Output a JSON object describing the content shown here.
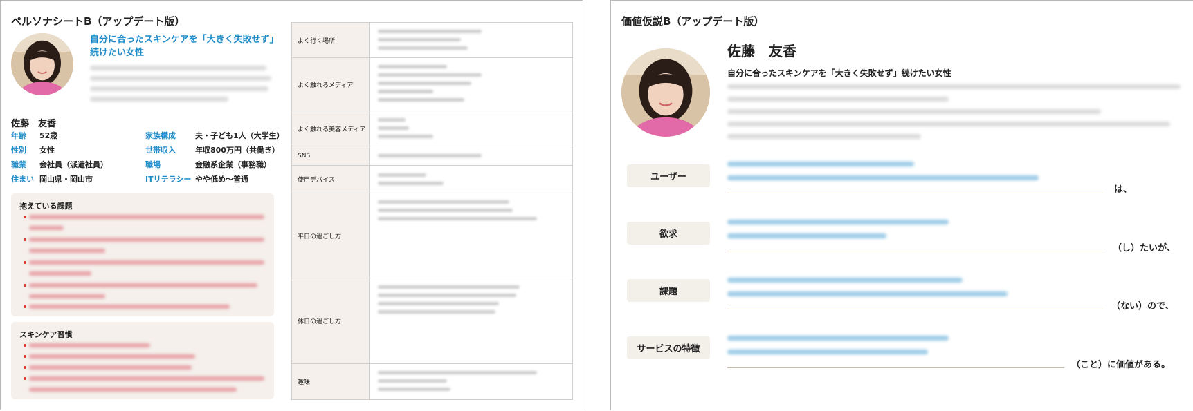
{
  "persona": {
    "title": "ペルソナシートB（アップデート版）",
    "headline": "自分に合ったスキンケアを「大きく失敗せず」続けたい女性",
    "name": "佐藤　友香",
    "attributes": [
      {
        "label": "年齢",
        "value": "52歳"
      },
      {
        "label": "家族構成",
        "value": "夫・子ども1人（大学生）"
      },
      {
        "label": "性別",
        "value": "女性"
      },
      {
        "label": "世帯収入",
        "value": "年収800万円（共働き）"
      },
      {
        "label": "職業",
        "value": "会社員（派遣社員）"
      },
      {
        "label": "職場",
        "value": "金融系企業（事務職）"
      },
      {
        "label": "住まい",
        "value": "岡山県・岡山市"
      },
      {
        "label": "ITリテラシー",
        "value": "やや低め〜普通"
      }
    ],
    "issues_title": "抱えている課題",
    "habits_title": "スキンケア習慣",
    "profile_rows": [
      "よく行く場所",
      "よく触れるメディア",
      "よく触れる美容メディア",
      "SNS",
      "使用デバイス",
      "平日の過ごし方",
      "休日の過ごし方",
      "趣味"
    ]
  },
  "value_hypothesis": {
    "title": "価値仮説B（アップデート版）",
    "name": "佐藤　友香",
    "subtitle": "自分に合ったスキンケアを「大きく失敗せず」続けたい女性",
    "rows": [
      {
        "label": "ユーザー",
        "suffix": "は、"
      },
      {
        "label": "欲求",
        "suffix": "（し）たいが、"
      },
      {
        "label": "課題",
        "suffix": "（ない）ので、"
      },
      {
        "label": "サービスの特徴",
        "suffix": "（こと）に価値がある。"
      }
    ]
  },
  "colors": {
    "accent": "#1f8cc9",
    "box_bg": "#f5f0eb",
    "bullet": "#d33333"
  }
}
